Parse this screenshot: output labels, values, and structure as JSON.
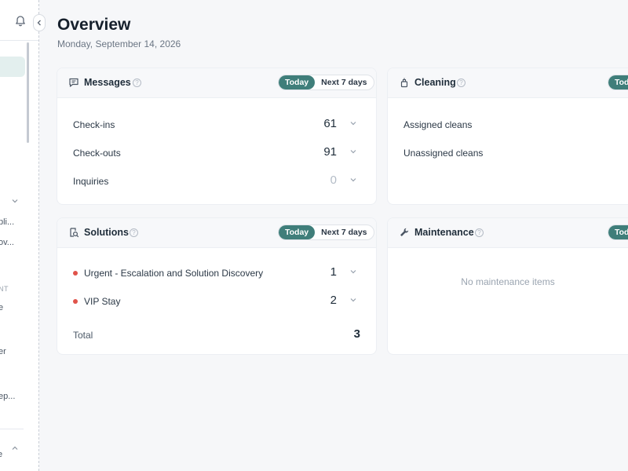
{
  "sidebar": {
    "items": [
      {
        "label": "pli..."
      },
      {
        "label": "ov..."
      },
      {
        "label": "e"
      },
      {
        "label": "er"
      },
      {
        "label": "ep..."
      },
      {
        "label": "e"
      }
    ],
    "section_label": "NT",
    "active_item_color": "#e3efee"
  },
  "header": {
    "title": "Overview",
    "date": "Monday, September 14, 2026"
  },
  "cards": {
    "messages": {
      "title": "Messages",
      "toggle": {
        "today": "Today",
        "next7": "Next 7 days",
        "active": "Today"
      },
      "rows": [
        {
          "label": "Check-ins",
          "value": "61"
        },
        {
          "label": "Check-outs",
          "value": "91"
        },
        {
          "label": "Inquiries",
          "value": "0"
        }
      ]
    },
    "cleaning": {
      "title": "Cleaning",
      "toggle": {
        "today": "Toda",
        "active": "Toda"
      },
      "rows": [
        {
          "label": "Assigned cleans"
        },
        {
          "label": "Unassigned cleans"
        }
      ]
    },
    "solutions": {
      "title": "Solutions",
      "toggle": {
        "today": "Today",
        "next7": "Next 7 days",
        "active": "Today"
      },
      "rows": [
        {
          "label": "Urgent - Escalation and Solution Discovery",
          "value": "1"
        },
        {
          "label": "VIP Stay",
          "value": "2"
        }
      ],
      "total_label": "Total",
      "total_value": "3"
    },
    "maintenance": {
      "title": "Maintenance",
      "toggle": {
        "today": "Toda",
        "active": "Toda"
      },
      "empty_text": "No maintenance items"
    }
  },
  "colors": {
    "accent": "#3f7e7a",
    "alert_dot": "#e0534a",
    "page_bg": "#f6f7f9"
  },
  "icons": [
    "bell-icon",
    "collapse-chevron-icon",
    "message-icon",
    "cleaning-spray-icon",
    "solutions-search-icon",
    "wrench-icon",
    "help-icon",
    "chevron-down-icon",
    "chevron-up-icon"
  ]
}
